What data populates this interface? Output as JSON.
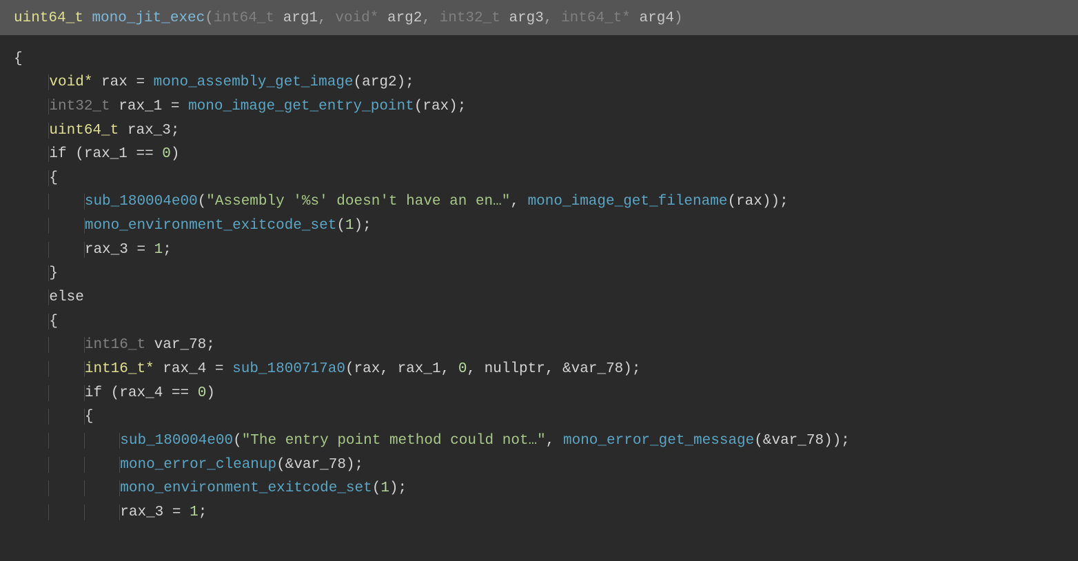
{
  "signature": {
    "ret_type": "uint64_t",
    "func_name": "mono_jit_exec",
    "p1_type": "int64_t",
    "p1_name": "arg1",
    "sep1": ", ",
    "p2_type": "void*",
    "p2_name": "arg2",
    "sep2": ", ",
    "p3_type": "int32_t",
    "p3_name": "arg3",
    "sep3": ", ",
    "p4_type": "int64_t*",
    "p4_name": "arg4"
  },
  "code": {
    "brace_open": "{",
    "l1_type": "void*",
    "l1_var": "rax",
    "l1_eq": " = ",
    "l1_call": "mono_assembly_get_image",
    "l1_arg": "arg2",
    "l2_type": "int32_t",
    "l2_var": "rax_1",
    "l2_eq": " = ",
    "l2_call": "mono_image_get_entry_point",
    "l2_arg": "rax",
    "l3_type": "uint64_t",
    "l3_var": "rax_3",
    "l4_if": "if",
    "l4_open": " (",
    "l4_var": "rax_1",
    "l4_op": " == ",
    "l4_val": "0",
    "l4_close": ")",
    "l5_brace": "{",
    "l6_call": "sub_180004e00",
    "l6_str": "\"Assembly '%s' doesn't have an en…\"",
    "l6_sep": ", ",
    "l6_call2": "mono_image_get_filename",
    "l6_arg2": "rax",
    "l7_call": "mono_environment_exitcode_set",
    "l7_arg": "1",
    "l8_var": "rax_3",
    "l8_eq": " = ",
    "l8_val": "1",
    "l9_brace": "}",
    "l10_else": "else",
    "l11_brace": "{",
    "l12_type": "int16_t",
    "l12_var": "var_78",
    "l13_type": "int16_t*",
    "l13_var": "rax_4",
    "l13_eq": " = ",
    "l13_call": "sub_1800717a0",
    "l13_a1": "rax",
    "l13_s1": ", ",
    "l13_a2": "rax_1",
    "l13_s2": ", ",
    "l13_a3": "0",
    "l13_s3": ", ",
    "l13_a4": "nullptr",
    "l13_s4": ", &",
    "l13_a5": "var_78",
    "l14_if": "if",
    "l14_open": " (",
    "l14_var": "rax_4",
    "l14_op": " == ",
    "l14_val": "0",
    "l14_close": ")",
    "l15_brace": "{",
    "l16_call": "sub_180004e00",
    "l16_str": "\"The entry point method could not…\"",
    "l16_sep": ", ",
    "l16_call2": "mono_error_get_message",
    "l16_arg2pre": "(&",
    "l16_arg2": "var_78",
    "l17_call": "mono_error_cleanup",
    "l17_argpre": "(&",
    "l17_arg": "var_78",
    "l18_call": "mono_environment_exitcode_set",
    "l18_arg": "1",
    "l19_var": "rax_3",
    "l19_eq": " = ",
    "l19_val": "1"
  }
}
